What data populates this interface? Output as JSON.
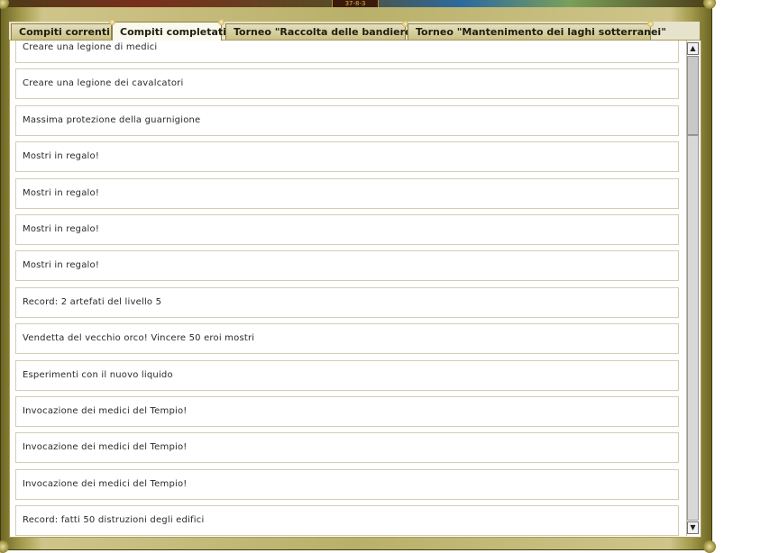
{
  "header": {
    "server_time": "37-8-3"
  },
  "tabs": [
    {
      "label": "Compiti correnti",
      "active": false
    },
    {
      "label": "Compiti completati",
      "active": true
    },
    {
      "label": "Torneo \"Raccolta delle bandiere\"",
      "active": false
    },
    {
      "label": "Torneo \"Mantenimento dei laghi sotterranei\"",
      "active": false
    }
  ],
  "quests": [
    "Creare una legione di medici",
    "Creare una legione dei cavalcatori",
    "Massima protezione della guarnigione",
    "Mostri in regalo!",
    "Mostri in regalo!",
    "Mostri in regalo!",
    "Mostri in regalo!",
    "Record: 2 artefati del livello 5",
    "Vendetta del vecchio orco! Vincere 50 eroi mostri",
    "Esperimenti con il nuovo liquido",
    "Invocazione dei medici del Tempio!",
    "Invocazione dei medici del Tempio!",
    "Invocazione dei medici del Tempio!",
    "Record: fatti 50 distruzioni degli edifici"
  ],
  "scrollbar": {
    "up_icon": "▲",
    "down_icon": "▼",
    "position_fraction": 0.0,
    "visible_fraction": 0.17
  },
  "colors": {
    "frame": "#b9b06a",
    "tab_active": "#fbf9ee",
    "row_border": "#d3cdb2"
  }
}
